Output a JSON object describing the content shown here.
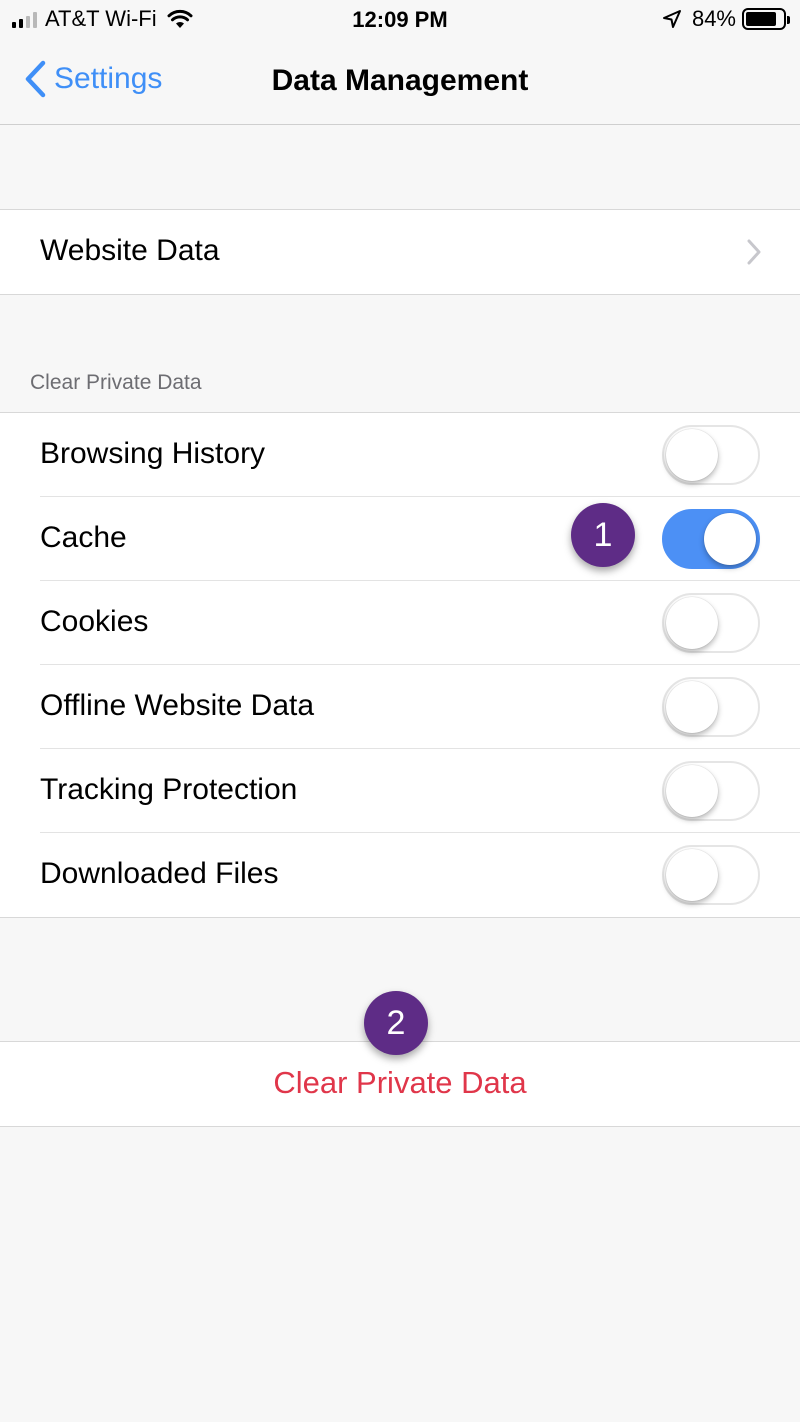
{
  "status_bar": {
    "carrier": "AT&T Wi-Fi",
    "time": "12:09 PM",
    "battery_percent": "84%",
    "battery_level": 0.84,
    "signal_bars": 2,
    "icons": [
      "signal-icon",
      "wifi-icon",
      "location-icon",
      "battery-icon"
    ]
  },
  "nav": {
    "back_label": "Settings",
    "title": "Data Management"
  },
  "website_data": {
    "label": "Website Data"
  },
  "clear_section": {
    "header": "Clear Private Data",
    "items": [
      {
        "label": "Browsing History",
        "enabled": false
      },
      {
        "label": "Cache",
        "enabled": true
      },
      {
        "label": "Cookies",
        "enabled": false
      },
      {
        "label": "Offline Website Data",
        "enabled": false
      },
      {
        "label": "Tracking Protection",
        "enabled": false
      },
      {
        "label": "Downloaded Files",
        "enabled": false
      }
    ]
  },
  "clear_button": {
    "label": "Clear Private Data",
    "color": "#e0364a"
  },
  "annotations": [
    {
      "text": "1"
    },
    {
      "text": "2"
    }
  ],
  "colors": {
    "accent": "#3f8ff7",
    "toggle_on": "#4c90f5",
    "badge": "#5e2c86",
    "destructive": "#e0364a"
  }
}
